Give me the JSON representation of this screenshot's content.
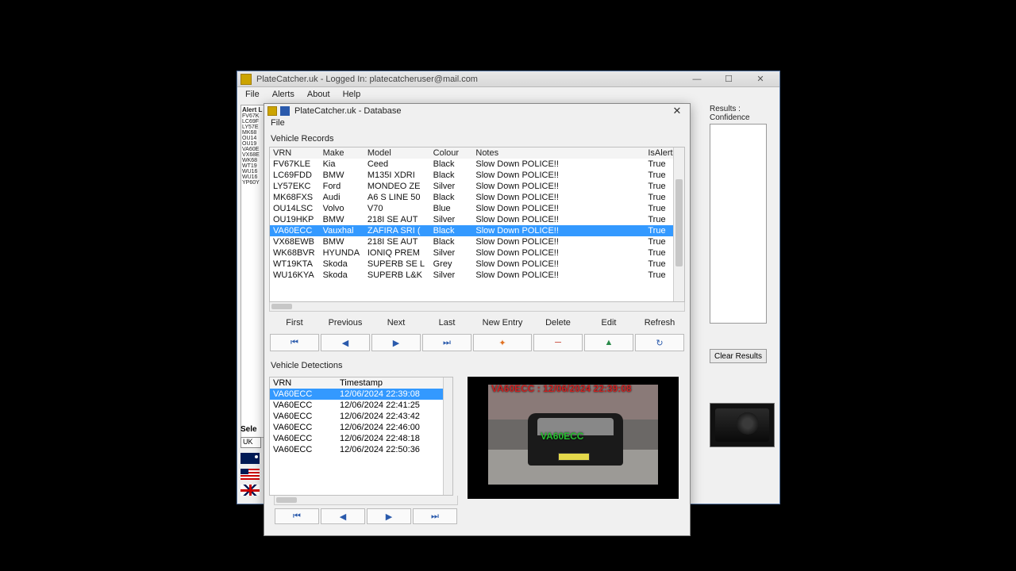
{
  "main_window": {
    "title": "PlateCatcher.uk - Logged In: platecatcheruser@mail.com",
    "menu": {
      "file": "File",
      "alerts": "Alerts",
      "about": "About",
      "help": "Help"
    },
    "alert_header": "Alert L",
    "alert_list": [
      "FV67K",
      "LC69F",
      "LY57E",
      "MK68",
      "OU14",
      "OU19",
      "VA60E",
      "VX68E",
      "WK68",
      "WT19",
      "WU16",
      "WU16",
      "YP60Y"
    ],
    "selector_label": "Sele",
    "uk_label": "UK",
    "results_header": "Results :  Confidence",
    "clear_results": "Clear Results"
  },
  "db_window": {
    "title": "PlateCatcher.uk - Database",
    "menu_file": "File",
    "records_title": "Vehicle Records",
    "columns": {
      "vrn": "VRN",
      "make": "Make",
      "model": "Model",
      "colour": "Colour",
      "notes": "Notes",
      "isalert": "IsAlert"
    },
    "rows": [
      {
        "vrn": "FV67KLE",
        "make": "Kia",
        "model": "Ceed",
        "colour": "Black",
        "notes": "Slow Down POLICE!!",
        "isalert": "True"
      },
      {
        "vrn": "LC69FDD",
        "make": "BMW",
        "model": "M135I XDRI",
        "colour": "Black",
        "notes": "Slow Down POLICE!!",
        "isalert": "True"
      },
      {
        "vrn": "LY57EKC",
        "make": "Ford",
        "model": "MONDEO ZE",
        "colour": "Silver",
        "notes": "Slow Down POLICE!!",
        "isalert": "True"
      },
      {
        "vrn": "MK68FXS",
        "make": "Audi",
        "model": "A6 S LINE 50",
        "colour": "Black",
        "notes": "Slow Down POLICE!!",
        "isalert": "True"
      },
      {
        "vrn": "OU14LSC",
        "make": "Volvo",
        "model": "V70",
        "colour": "Blue",
        "notes": "Slow Down POLICE!!",
        "isalert": "True"
      },
      {
        "vrn": "OU19HKP",
        "make": "BMW",
        "model": "218I SE AUT",
        "colour": "Silver",
        "notes": "Slow Down POLICE!!",
        "isalert": "True"
      },
      {
        "vrn": "VA60ECC",
        "make": "Vauxhal",
        "model": "ZAFIRA SRI (",
        "colour": "Black",
        "notes": "Slow Down POLICE!!",
        "isalert": "True"
      },
      {
        "vrn": "VX68EWB",
        "make": "BMW",
        "model": "218I SE AUT",
        "colour": "Black",
        "notes": "Slow Down POLICE!!",
        "isalert": "True"
      },
      {
        "vrn": "WK68BVR",
        "make": "HYUNDA",
        "model": "IONIQ PREM",
        "colour": "Silver",
        "notes": "Slow Down POLICE!!",
        "isalert": "True"
      },
      {
        "vrn": "WT19KTA",
        "make": "Skoda",
        "model": "SUPERB SE L",
        "colour": "Grey",
        "notes": "Slow Down POLICE!!",
        "isalert": "True"
      },
      {
        "vrn": "WU16KYA",
        "make": "Skoda",
        "model": "SUPERB L&K",
        "colour": "Silver",
        "notes": "Slow Down POLICE!!",
        "isalert": "True"
      }
    ],
    "selected_row": 6,
    "nav": {
      "first": "First",
      "previous": "Previous",
      "next": "Next",
      "last": "Last",
      "new": "New Entry",
      "delete": "Delete",
      "edit": "Edit",
      "refresh": "Refresh"
    },
    "detections_title": "Vehicle Detections",
    "det_columns": {
      "vrn": "VRN",
      "timestamp": "Timestamp"
    },
    "detections": [
      {
        "vrn": "VA60ECC",
        "ts": "12/06/2024 22:39:08"
      },
      {
        "vrn": "VA60ECC",
        "ts": "12/06/2024 22:41:25"
      },
      {
        "vrn": "VA60ECC",
        "ts": "12/06/2024 22:43:42"
      },
      {
        "vrn": "VA60ECC",
        "ts": "12/06/2024 22:46:00"
      },
      {
        "vrn": "VA60ECC",
        "ts": "12/06/2024 22:48:18"
      },
      {
        "vrn": "VA60ECC",
        "ts": "12/06/2024 22:50:36"
      }
    ],
    "det_selected": 0,
    "preview_overlay_top": "VA60ECC : 12/06/2024 22:39:08",
    "preview_overlay_mid": "VA60ECC"
  }
}
